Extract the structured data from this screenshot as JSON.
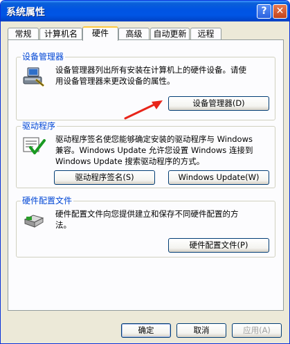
{
  "window": {
    "title": "系统属性",
    "help_label": "?",
    "close_label": "✕"
  },
  "tabs": [
    {
      "label": "常规"
    },
    {
      "label": "计算机名"
    },
    {
      "label": "硬件",
      "active": true
    },
    {
      "label": "高级"
    },
    {
      "label": "自动更新"
    },
    {
      "label": "远程"
    }
  ],
  "device_manager": {
    "title": "设备管理器",
    "description_line1": "设备管理器列出所有安装在计算机上的硬件设备。请使",
    "description_line2": "用设备管理器来更改设备的属性。",
    "button_label": "设备管理器(D)",
    "icon": "device-manager-icon"
  },
  "drivers": {
    "title": "驱动程序",
    "description_line1": "驱动程序签名使您能够确定安装的驱动程序与 Windows",
    "description_line2": "兼容。Windows Update 允许您设置 Windows 连接到",
    "description_line3": "Windows Update 搜索驱动程序的方式。",
    "signing_button_label": "驱动程序签名(S)",
    "update_button_label": "Windows Update(W)",
    "icon": "driver-signing-icon"
  },
  "hardware_profiles": {
    "title": "硬件配置文件",
    "description_line1": "硬件配置文件向您提供建立和保存不同硬件配置的方",
    "description_line2": "法。",
    "button_label": "硬件配置文件(P)",
    "icon": "hardware-profile-icon"
  },
  "footer": {
    "ok_label": "确定",
    "cancel_label": "取消",
    "apply_label": "应用(A)"
  },
  "colors": {
    "titlebar": "#0054e3",
    "group_label": "#0046d5",
    "annotation_arrow": "#e8251a"
  }
}
